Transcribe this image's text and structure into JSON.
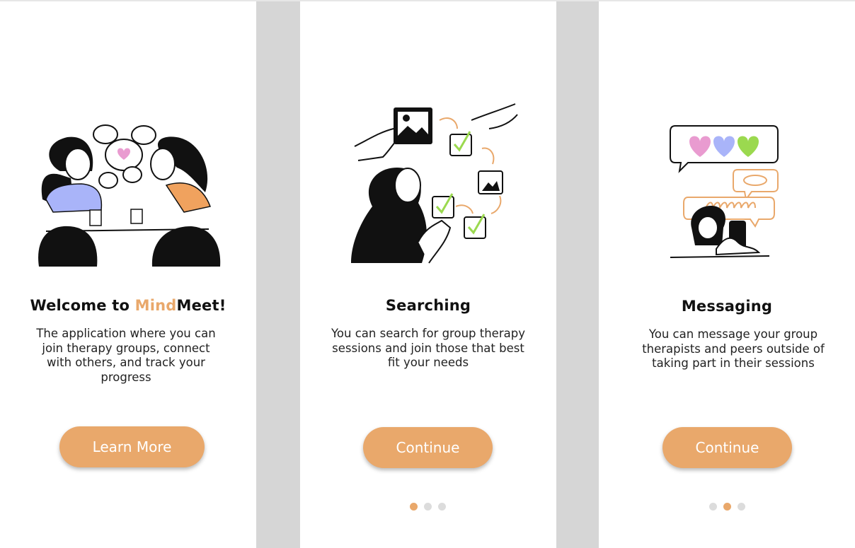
{
  "colors": {
    "accent": "#e9a86b",
    "inactive_dot": "#dcdcdc",
    "background": "#d6d6d6"
  },
  "screens": [
    {
      "title_prefix": "Welcome to ",
      "title_accent": "Mind",
      "title_suffix": "Meet!",
      "description": "The application where you can join therapy groups, connect with others, and track your progress",
      "button_label": "Learn More",
      "illustration_icon": "two-women-chatting-illustration"
    },
    {
      "title": "Searching",
      "description": "You can search for group therapy sessions and join those that best fit your needs",
      "button_label": "Continue",
      "illustration_icon": "woman-searching-illustration",
      "page_indicator": {
        "active": 1,
        "count": 3
      }
    },
    {
      "title": "Messaging",
      "description": "You can message your group therapists and peers outside of taking part in their sessions",
      "button_label": "Continue",
      "illustration_icon": "person-messaging-illustration",
      "page_indicator": {
        "active": 2,
        "count": 3
      }
    }
  ]
}
